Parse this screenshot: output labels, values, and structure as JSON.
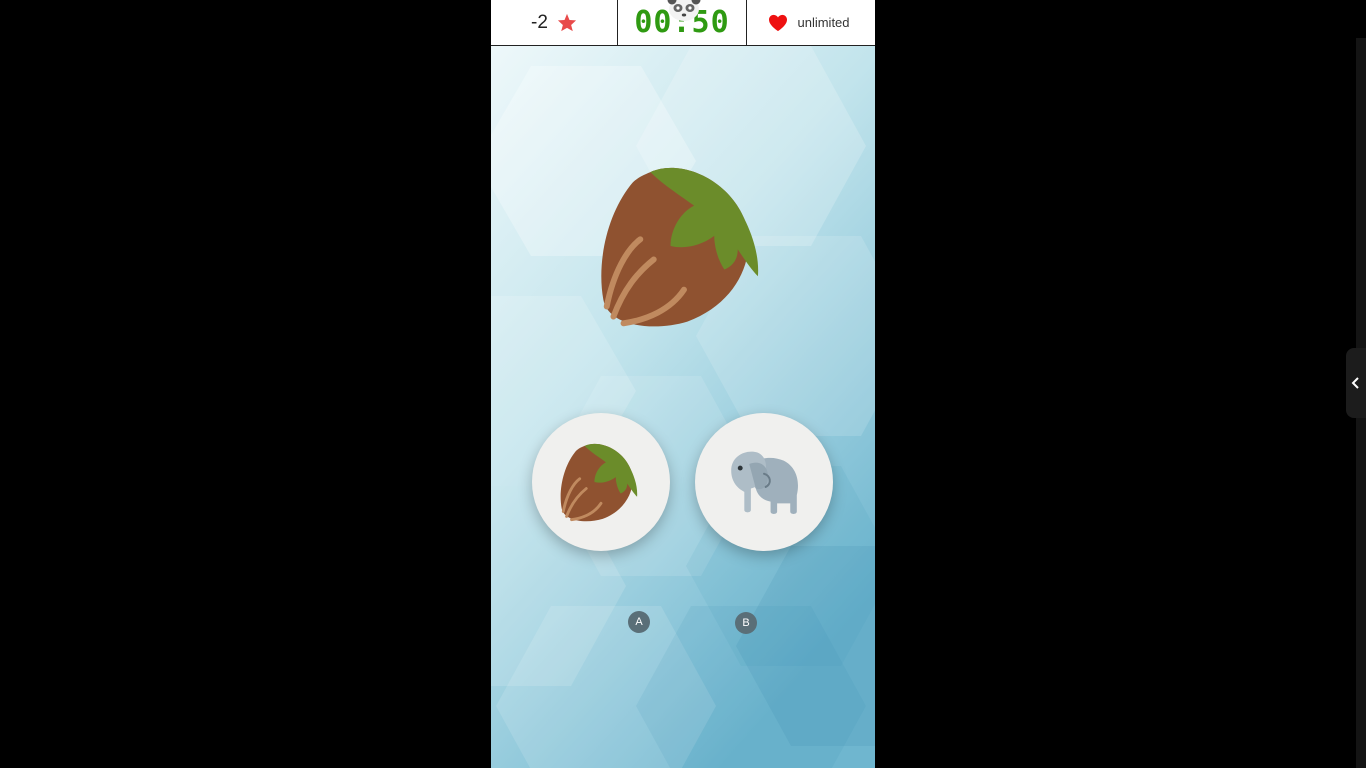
{
  "topbar": {
    "score": "-2",
    "score_icon": "star-icon",
    "timer": "00:50",
    "timer_color": "#2f9a12",
    "mascot_icon": "panda-icon",
    "lives_icon": "heart-icon",
    "lives": "unlimited"
  },
  "prompt": {
    "image": "hazelnut-icon"
  },
  "options": [
    {
      "key": "A",
      "image": "hazelnut-icon"
    },
    {
      "key": "B",
      "image": "elephant-icon"
    }
  ],
  "side_panel": {
    "icon": "chevron-left-icon"
  },
  "colors": {
    "star": "#e84a4a",
    "heart": "#ee1111",
    "key_badge": "#5a6f78",
    "nut_shell": "#8f5230",
    "nut_leaf": "#6b8c2a",
    "elephant": "#9fb0bc"
  }
}
